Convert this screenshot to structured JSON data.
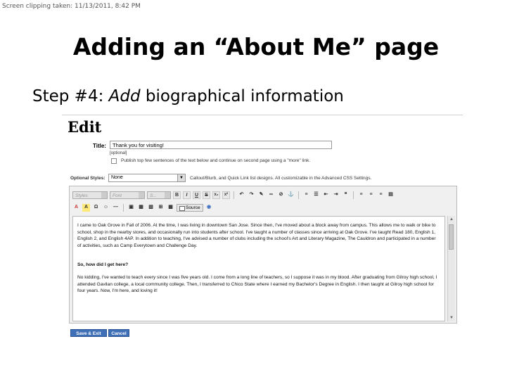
{
  "caption": "Screen clipping taken: 11/13/2011, 8:42 PM",
  "slide": {
    "title": "Adding an “About Me” page",
    "subtitle_prefix": "Step #4: ",
    "subtitle_em": "Add",
    "subtitle_suffix": " biographical information"
  },
  "editor_page": {
    "heading": "Edit",
    "title_label": "Title:",
    "title_value": "Thank you for visiting!",
    "optional_note": "[optional]",
    "publish_text": "Publish top few sentences of the text below and continue on second page using a \"more\" link.",
    "optional_styles_label": "Optional Styles:",
    "optional_styles_value": "None",
    "optional_styles_desc": "Callout/Blurb, and Quick Link list designs.  All customizable in the Advanced CSS Settings.",
    "toolbar": {
      "styles_placeholder": "Styles",
      "font_placeholder": "Font",
      "size_placeholder": "S...",
      "source_label": "Source"
    },
    "content": {
      "para1": "I came to Oak Grove in Fall of 2006.  At the time, I was living in downtown San Jose. Since then, I've moved about a block away from campus. This allows me to walk or bike to school, shop in the nearby stores, and occasionally run into students after school.  I've taught a number of classes since arriving at Oak Grove.  I've taught Read 180, English 1, English 2, and English 4AP. In addition to teaching, I've advised a number of clubs including the school's Art and Literary Magazine, The Cauldron and participated in a number of activities, such as Camp Everytown and Challenge Day.",
      "subhead": "So, how did I get here?",
      "para2": "No kidding, I've wanted to teach every since I was five years old.  I come from a long line of teachers, so I suppose it was in my blood.  After graduating from Gilroy high school, I attended Gavilan college, a local community college.  Then, I transferred to Chico State where I earned my Bachelor's Degree in English. I then taught at Gilroy high school for four years.  Now, I'm here, and loving it!"
    },
    "save_label": "Save & Exit",
    "cancel_label": "Cancel"
  }
}
